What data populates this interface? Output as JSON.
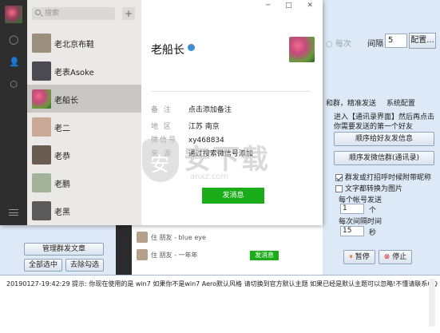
{
  "tool": {
    "faded_label": "○ 每次",
    "interval_label": "间隔",
    "interval_value": "5",
    "config_button": "配置...",
    "tabs": [
      "和群，精准发送",
      "系统配置"
    ],
    "instruction": "进入【通讯录界面】然后再点击你需要发送的第一个好友",
    "btn_friends": "顺序给好友发信息",
    "btn_groups": "顺序发微信群(通讯录)",
    "chk_close_voice": "群发或打招呼时候附带昵称",
    "chk_text_to_image": "文字都转换为图片",
    "per_account_label": "每个帐号发送",
    "per_account_value": "1",
    "per_account_unit": "个",
    "interval2_label": "每次间隔时间",
    "interval2_value": "15",
    "interval2_unit": "秒",
    "btn_pause": "暂停",
    "btn_stop": "停止",
    "btn_manage": "管理群发文章",
    "btn_select_all": "全部选中",
    "btn_deselect": "去除勾选",
    "log_text": "20190127-19:42:29  提示: 你现在使用的是 win7 如果你不是win7 Aero默认风格 请切换到官方默认主题 如果已经是默认主题可以忽略!不懂请联系QQ 1959322593,点击打开帮助帮",
    "chat_rows": [
      {
        "text": "住 朋友 - blue eye"
      },
      {
        "text": "住 朋友 - 一年年"
      }
    ],
    "chat_send": "发消息"
  },
  "wechat": {
    "search_placeholder": "搜索",
    "add_icon": "+",
    "window_controls": "─ □ ✕",
    "contacts": [
      {
        "name": "老北京布鞋",
        "color": "#9a8f7c"
      },
      {
        "name": "老表Asoke",
        "color": "#4b4a52"
      },
      {
        "name": "老船长",
        "color": "#c56a83",
        "selected": true
      },
      {
        "name": "老二",
        "color": "#c9a895"
      },
      {
        "name": "老恭",
        "color": "#6b5c51"
      },
      {
        "name": "老鹏",
        "color": "#a3b39a"
      },
      {
        "name": "老黑",
        "color": "#5a5a5a"
      }
    ],
    "profile": {
      "name": "老船长",
      "rows": [
        {
          "key": "备 注",
          "value": "点击添加备注"
        },
        {
          "key": "地 区",
          "value": "江苏 南京"
        },
        {
          "key": "微信号",
          "value": "xy468834"
        },
        {
          "key": "来 源",
          "value": "通过搜索微信号添加"
        }
      ],
      "send_button": "发消息"
    }
  },
  "watermark": {
    "text": "安下载",
    "url": "anxz.com"
  }
}
